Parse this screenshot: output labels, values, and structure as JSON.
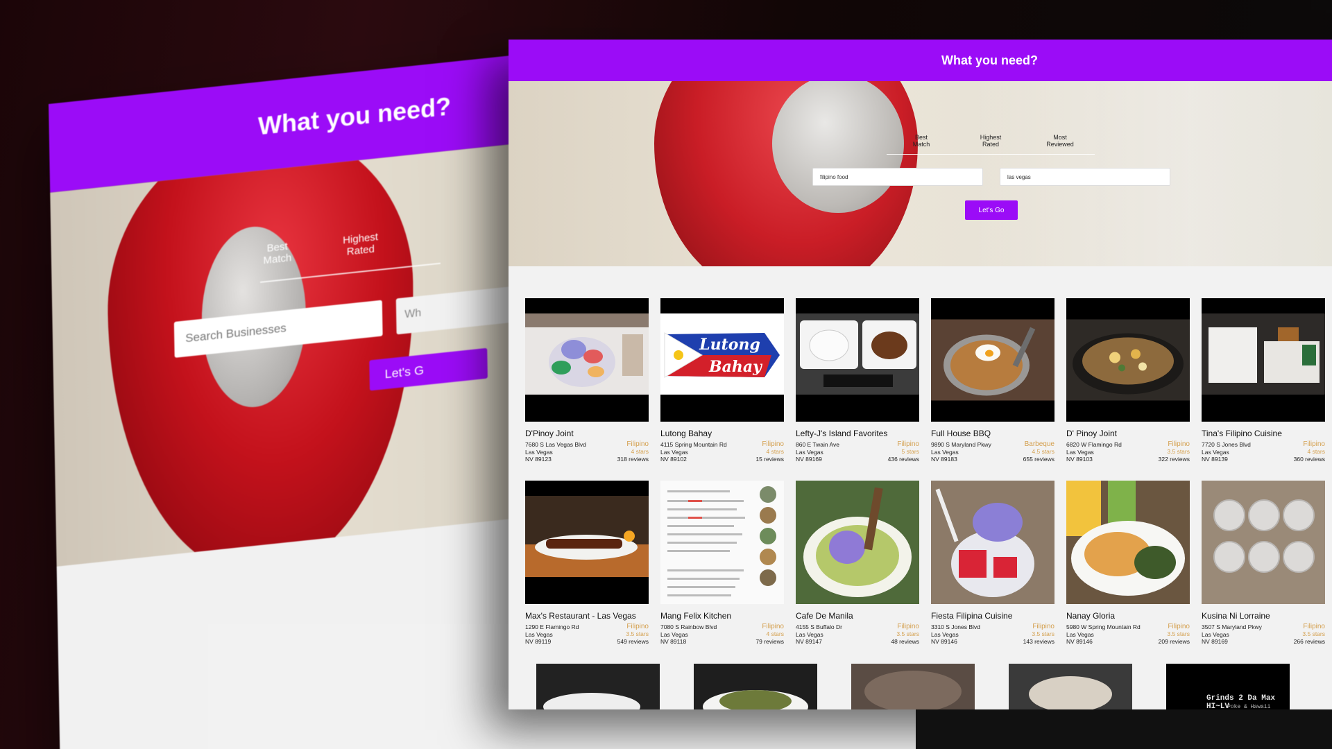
{
  "app": {
    "header_title": "What you need?"
  },
  "background_screen": {
    "header_title": "What you need?",
    "tab_best": "Best\nMatch",
    "tab_highest": "Highest\nRated",
    "tab_partial": "Wh",
    "search_placeholder": "Search Businesses",
    "button_label": "Let's G"
  },
  "sort_tabs": [
    {
      "label_line1": "Best",
      "label_line2": "Match"
    },
    {
      "label_line1": "Highest",
      "label_line2": "Rated"
    },
    {
      "label_line1": "Most",
      "label_line2": "Reviewed"
    }
  ],
  "search": {
    "term_value": "filipino food",
    "location_value": "las vegas",
    "button_label": "Let's Go"
  },
  "colors": {
    "accent": "#9b0cf7",
    "category": "#d4a04f"
  },
  "businesses": [
    {
      "name": "D'Pinoy Joint",
      "address": "7680 S Las Vegas Blvd",
      "city": "Las Vegas",
      "state_zip": "NV 89123",
      "category": "Filipino",
      "rating": "4 stars",
      "reviews": "318 reviews",
      "photo": "halo-halo dessert"
    },
    {
      "name": "Lutong Bahay",
      "address": "4115 Spring Mountain Rd",
      "city": "Las Vegas",
      "state_zip": "NV 89102",
      "category": "Filipino",
      "rating": "4 stars",
      "reviews": "15 reviews",
      "photo": "flag logo",
      "logo_line1": "Lutong",
      "logo_line2": "Bahay"
    },
    {
      "name": "Lefty-J's Island Favorites",
      "address": "860 E Twain Ave",
      "city": "Las Vegas",
      "state_zip": "NV 89169",
      "category": "Filipino",
      "rating": "5 stars",
      "reviews": "436 reviews",
      "photo": "takeout plates"
    },
    {
      "name": "Full House BBQ",
      "address": "9890 S Maryland Pkwy",
      "city": "Las Vegas",
      "state_zip": "NV 89183",
      "category": "Barbeque",
      "rating": "4.5 stars",
      "reviews": "655 reviews",
      "photo": "fried rice with egg"
    },
    {
      "name": "D' Pinoy Joint",
      "address": "6820 W Flamingo Rd",
      "city": "Las Vegas",
      "state_zip": "NV 89103",
      "category": "Filipino",
      "rating": "3.5 stars",
      "reviews": "322 reviews",
      "photo": "sizzling plate"
    },
    {
      "name": "Tina's Filipino Cuisine",
      "address": "7720 S Jones Blvd",
      "city": "Las Vegas",
      "state_zip": "NV 89139",
      "category": "Filipino",
      "rating": "4 stars",
      "reviews": "360 reviews",
      "photo": "takeout box"
    },
    {
      "name": "Max's Restaurant - Las Vegas",
      "address": "1290 E Flamingo Rd",
      "city": "Las Vegas",
      "state_zip": "NV 89119",
      "category": "Filipino",
      "rating": "3.5 stars",
      "reviews": "549 reviews",
      "photo": "barbecue skewers"
    },
    {
      "name": "Mang Felix Kitchen",
      "address": "7080 S Rainbow Blvd",
      "city": "Las Vegas",
      "state_zip": "NV 89118",
      "category": "Filipino",
      "rating": "4 stars",
      "reviews": "79 reviews",
      "photo": "menu page"
    },
    {
      "name": "Cafe De Manila",
      "address": "4155 S Buffalo Dr",
      "city": "Las Vegas",
      "state_zip": "NV 89147",
      "category": "Filipino",
      "rating": "3.5 stars",
      "reviews": "48 reviews",
      "photo": "ube dessert"
    },
    {
      "name": "Fiesta Filipina Cuisine",
      "address": "3310 S Jones Blvd",
      "city": "Las Vegas",
      "state_zip": "NV 89146",
      "category": "Filipino",
      "rating": "3.5 stars",
      "reviews": "143 reviews",
      "photo": "halo-halo glass"
    },
    {
      "name": "Nanay Gloria",
      "address": "5980 W Spring Mountain Rd",
      "city": "Las Vegas",
      "state_zip": "NV 89146",
      "category": "Filipino",
      "rating": "3.5 stars",
      "reviews": "209 reviews",
      "photo": "pancit plate"
    },
    {
      "name": "Kusina Ni Lorraine",
      "address": "3507 S Maryland Pkwy",
      "city": "Las Vegas",
      "state_zip": "NV 89169",
      "category": "Filipino",
      "rating": "3.5 stars",
      "reviews": "266 reviews",
      "photo": "dessert cups"
    }
  ],
  "partial_row": {
    "last_card_text": "Grinds 2 Da Max HI~LV",
    "last_card_subtext": "Poke & Hawaii Kineys"
  }
}
